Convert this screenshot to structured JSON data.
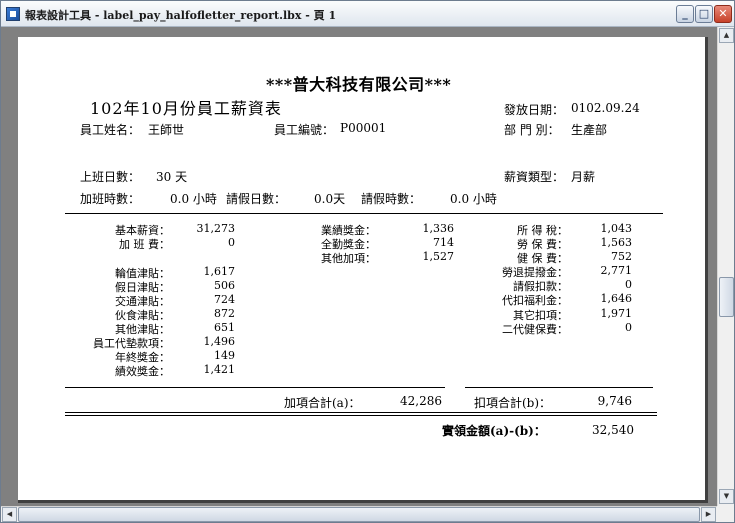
{
  "window": {
    "title": "報表設計工具 - label_pay_halfofletter_report.lbx - 頁 1",
    "min_glyph": "_",
    "max_glyph": "□",
    "close_glyph": "✕"
  },
  "scroll": {
    "up": "▲",
    "down": "▼",
    "left": "◀",
    "right": "▶"
  },
  "report": {
    "company": "***普大科技有限公司***",
    "title": "102年10月份員工薪資表",
    "issue_date_label": "發放日期：",
    "issue_date": "0102.09.24",
    "employee_name_label": "員工姓名：",
    "employee_name": "王師世",
    "employee_id_label": "員工編號：",
    "employee_id": "P00001",
    "department_label": "部 門 別：",
    "department": "生產部",
    "work_days_label": "上班日數：",
    "work_days": "30 天",
    "pay_type_label": "薪資類型：",
    "pay_type": "月薪",
    "overtime_label": "加班時數：",
    "overtime": "0.0 小時",
    "leave_days_label": "請假日數：",
    "leave_days": "0.0天",
    "leave_hours_label": "請假時數：",
    "leave_hours": "0.0 小時",
    "col1": [
      {
        "label": "基本薪資：",
        "value": "31,273"
      },
      {
        "label": "加 班 費：",
        "value": "0"
      },
      {
        "label": "輪值津貼：",
        "value": "1,617"
      },
      {
        "label": "假日津貼：",
        "value": "506"
      },
      {
        "label": "交通津貼：",
        "value": "724"
      },
      {
        "label": "伙食津貼：",
        "value": "872"
      },
      {
        "label": "其他津貼：",
        "value": "651"
      },
      {
        "label": "員工代墊款項：",
        "value": "1,496"
      },
      {
        "label": "年終獎金：",
        "value": "149"
      },
      {
        "label": "績效獎金：",
        "value": "1,421"
      }
    ],
    "col2": [
      {
        "label": "業績獎金：",
        "value": "1,336"
      },
      {
        "label": "全勤獎金：",
        "value": "714"
      },
      {
        "label": "其他加項：",
        "value": "1,527"
      }
    ],
    "col3": [
      {
        "label": "所 得 稅：",
        "value": "1,043"
      },
      {
        "label": "勞 保 費：",
        "value": "1,563"
      },
      {
        "label": "健 保 費：",
        "value": "752"
      },
      {
        "label": "勞退提撥金：",
        "value": "2,771"
      },
      {
        "label": "請假扣款：",
        "value": "0"
      },
      {
        "label": "代扣福利金：",
        "value": "1,646"
      },
      {
        "label": "其它扣項：",
        "value": "1,971"
      },
      {
        "label": "二代健保費：",
        "value": "0"
      }
    ],
    "add_total_label": "加項合計(a)：",
    "add_total": "42,286",
    "deduct_total_label": "扣項合計(b)：",
    "deduct_total": "9,746",
    "net_label": "實領金額(a)-(b)：",
    "net": "32,540"
  }
}
